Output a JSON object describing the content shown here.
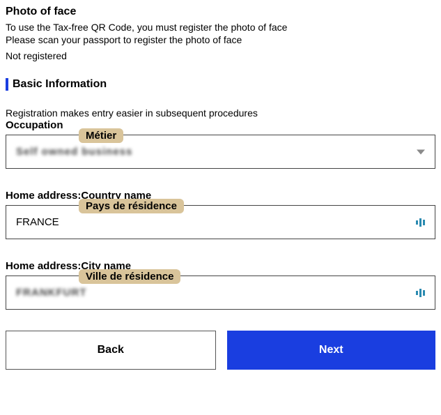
{
  "photo_section": {
    "title": "Photo of face",
    "line1": "To use the Tax-free QR Code, you must register the photo of face",
    "line2": "Please scan your passport to register the photo of face",
    "status": "Not registered"
  },
  "basic_section": {
    "title": "Basic Information",
    "subtext": "Registration makes entry easier in subsequent procedures"
  },
  "occupation": {
    "label": "Occupation",
    "badge": "Métier",
    "value": "Self owned business"
  },
  "country": {
    "label": "Home address:Country name",
    "badge": "Pays de résidence",
    "value": "FRANCE"
  },
  "city": {
    "label": "Home address:City name",
    "badge": "Ville de résidence",
    "value": "FRANKFURT"
  },
  "buttons": {
    "back": "Back",
    "next": "Next"
  }
}
